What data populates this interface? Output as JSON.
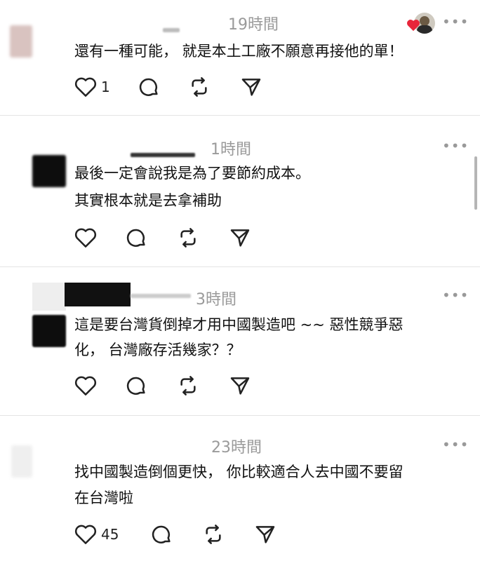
{
  "comments": [
    {
      "time": "19時間",
      "lines": [
        "還有一種可能， 就是本土工廠不願意再接他的單！"
      ],
      "like_count": "1"
    },
    {
      "time": "1時間",
      "lines": [
        "最後一定會說我是為了要節約成本。",
        "其實根本就是去拿補助"
      ],
      "like_count": ""
    },
    {
      "time": "3時間",
      "lines": [
        "這是要台灣貨倒掉才用中國製造吧 ~~ 惡性競爭惡",
        "化， 台灣廠存活幾家？？"
      ],
      "like_count": ""
    },
    {
      "time": "23時間",
      "lines": [
        "找中國製造倒個更快， 你比較適合人去中國不要留",
        "在台灣啦"
      ],
      "like_count": "45"
    }
  ],
  "more_label": "•••",
  "icons": {
    "like": "heart-icon",
    "reply": "comment-bubble-icon",
    "repost": "repost-icon",
    "share": "send-icon",
    "more": "more-dots-icon"
  },
  "colors": {
    "heart_badge": "#e8253a",
    "time_gray": "#9a9a9a",
    "divider": "#e4e4e4"
  }
}
